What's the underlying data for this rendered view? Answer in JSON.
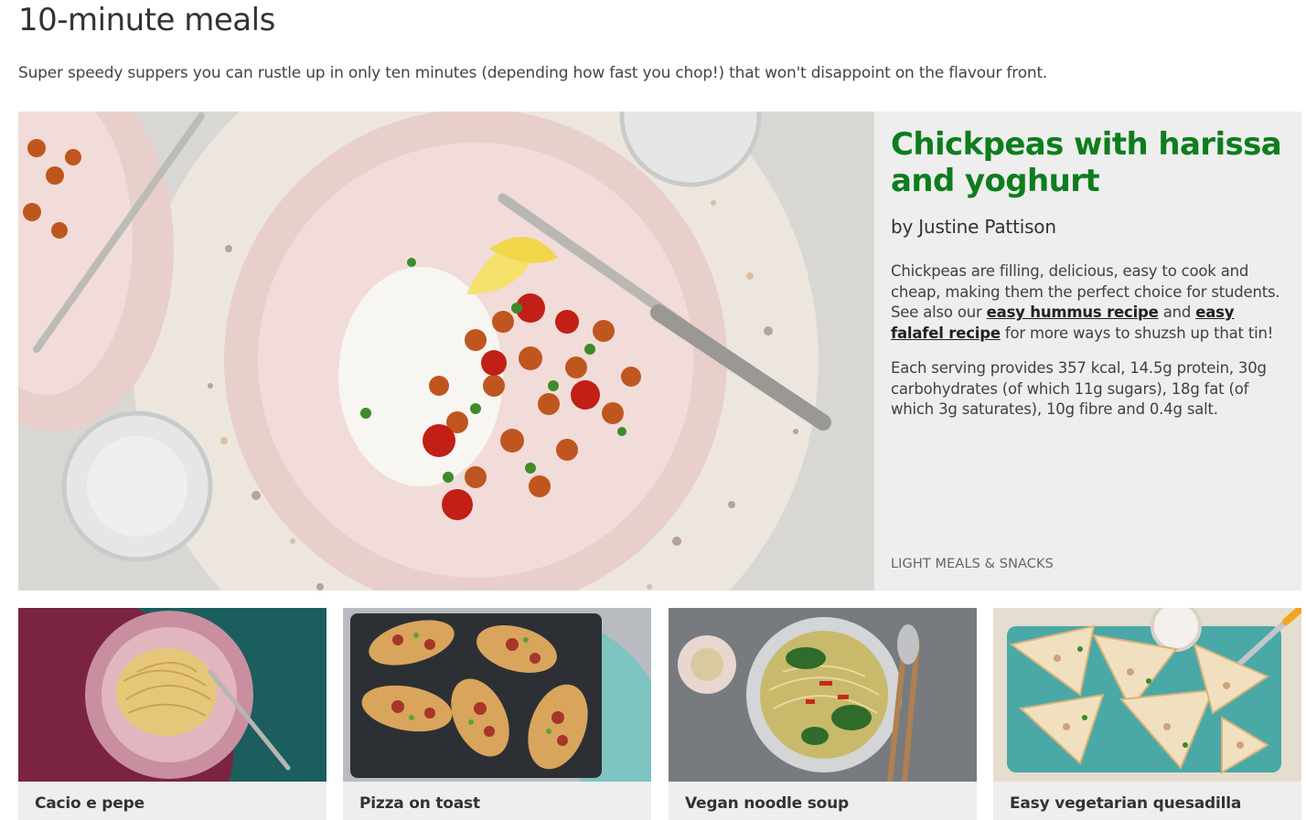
{
  "page": {
    "title": "10-minute meals",
    "intro": "Super speedy suppers you can rustle up in only ten minutes (depending how fast you chop!) that won't disappoint on the flavour front."
  },
  "hero": {
    "title": "Chickpeas with harissa and yoghurt",
    "author": "by Justine Pattison",
    "desc_before": "Chickpeas are filling, delicious, easy to cook and cheap, making them the perfect choice for students. See also our ",
    "link1": "easy hummus recipe",
    "desc_middle": " and ",
    "link2": "easy falafel recipe",
    "desc_after": " for more ways to shuzsh up that tin!",
    "nutrition": "Each serving provides 357 kcal, 14.5g protein, 30g carbohydrates (of which 11g sugars), 18g fat (of which 3g saturates), 10g fibre and 0.4g salt.",
    "category": "LIGHT MEALS & SNACKS"
  },
  "cards": [
    {
      "title": "Cacio e pepe"
    },
    {
      "title": "Pizza on toast"
    },
    {
      "title": "Vegan noodle soup"
    },
    {
      "title": "Easy vegetarian quesadilla"
    }
  ],
  "colors": {
    "accent_green": "#0d7d1d",
    "panel_grey": "#eeeeee"
  }
}
